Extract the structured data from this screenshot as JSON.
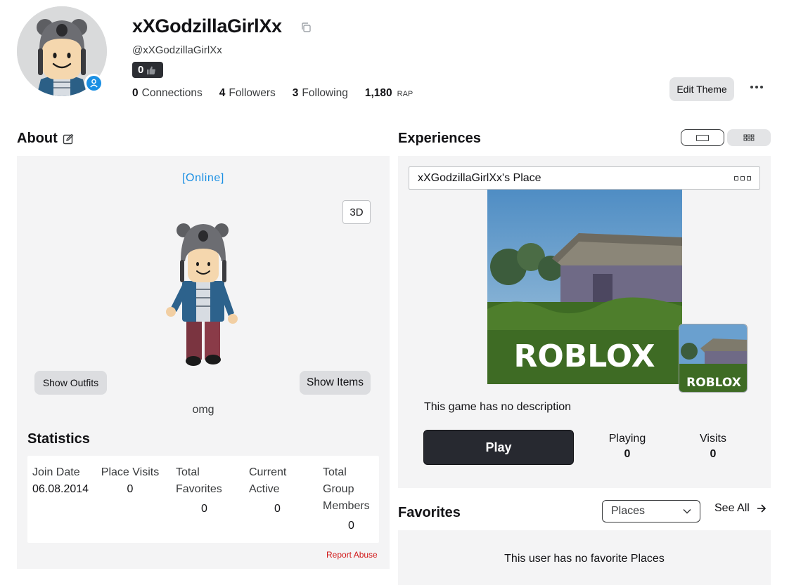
{
  "profile": {
    "display_name": "xXGodzillaGirlXx",
    "username": "@xXGodzillaGirlXx",
    "reputation": "0",
    "connections": {
      "count": "0",
      "label": "Connections"
    },
    "followers": {
      "count": "4",
      "label": "Followers"
    },
    "following": {
      "count": "3",
      "label": "Following"
    },
    "rap": {
      "value": "1,180",
      "label": "RAP"
    },
    "edit_theme_label": "Edit Theme",
    "online_color": "#1a8fe3"
  },
  "about": {
    "title": "About",
    "presence": "[Online]",
    "view_3d_label": "3D",
    "show_outfits_label": "Show Outfits",
    "show_items_label": "Show Items",
    "blurb": "omg",
    "report_abuse": "Report Abuse",
    "statistics": {
      "title": "Statistics",
      "items": [
        {
          "label": "Join Date",
          "value": "06.08.2014"
        },
        {
          "label": "Place Visits",
          "value": "0"
        },
        {
          "label": "Total Favorites",
          "value": "0"
        },
        {
          "label": "Current Active",
          "value": "0"
        },
        {
          "label": "Total Group Members",
          "value": "0"
        }
      ]
    }
  },
  "experiences": {
    "title": "Experiences",
    "place_name": "xXGodzillaGirlXx's Place",
    "thumbnail_logo": "ROBLOX",
    "description": "This game has no description",
    "play_label": "Play",
    "playing": {
      "label": "Playing",
      "value": "0"
    },
    "visits": {
      "label": "Visits",
      "value": "0"
    }
  },
  "favorites": {
    "title": "Favorites",
    "filter_selected": "Places",
    "see_all_label": "See All",
    "empty_message": "This user has no favorite Places"
  }
}
